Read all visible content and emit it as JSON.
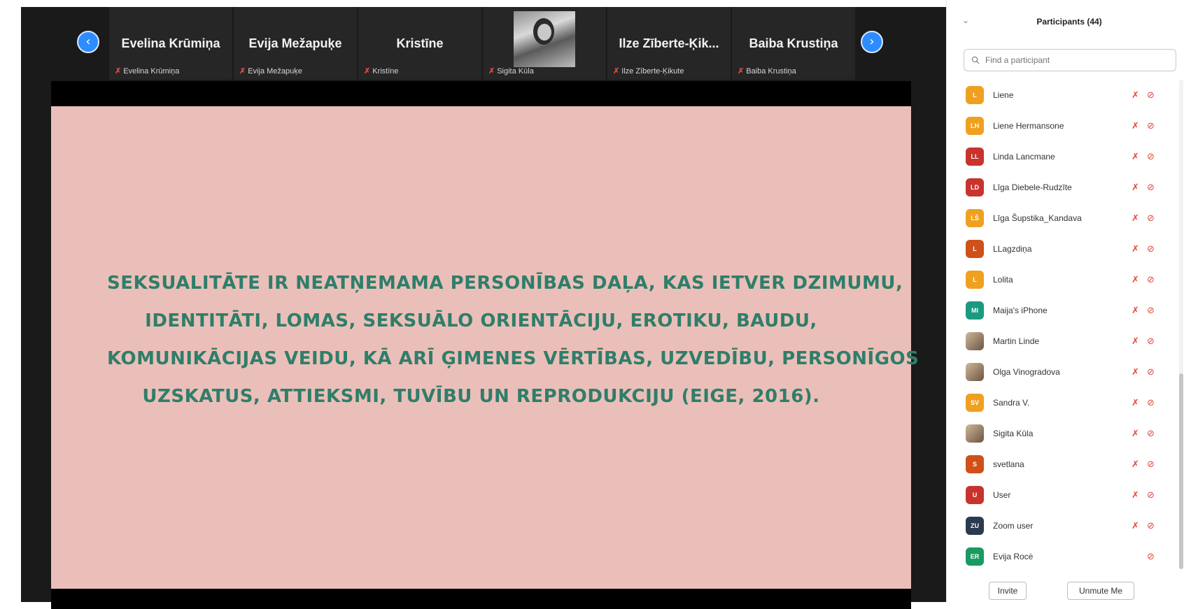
{
  "gallery": {
    "tiles": [
      {
        "name": "Evelina Krūmiņa",
        "label": "Evelina Krūmiņa"
      },
      {
        "name": "Evija Mežapuķe",
        "label": "Evija Mežapuķe"
      },
      {
        "name": "Kristīne",
        "label": "Kristīne"
      },
      {
        "name": "",
        "label": "Sigita Kūla"
      },
      {
        "name": "Ilze Zīberte-Ķik...",
        "label": "Ilze Zīberte-Ķikute"
      },
      {
        "name": "Baiba Krustiņa",
        "label": "Baiba Krustiņa"
      }
    ],
    "prev_icon": "‹",
    "next_icon": "›"
  },
  "slide": {
    "lines": [
      "SEKSUALITĀTE IR NEATŅEMAMA PERSONĪBAS DAĻA, KAS IETVER DZIMUMU,",
      "IDENTITĀTI, LOMAS, SEKSUĀLO ORIENTĀCIJU, EROTIKU, BAUDU,",
      "KOMUNIKĀCIJAS VEIDU, KĀ ARĪ ĢIMENES VĒRTĪBAS, UZVEDĪBU, PERSONĪGOS",
      "UZSKATUS, ATTIEKSMI, TUVĪBU UN REPRODUKCIJU (EIGE, 2016)."
    ],
    "text_color": "#2f7e6a",
    "background": "#ebbfb9"
  },
  "panel": {
    "title": "Participants (44)",
    "search_placeholder": "Find a participant",
    "participants": [
      {
        "initials": "L",
        "name": "Liene",
        "color": "#f0a020",
        "cam": true
      },
      {
        "initials": "LH",
        "name": "Liene Hermansone",
        "color": "#f0a020",
        "cam": true
      },
      {
        "initials": "LL",
        "name": "Linda Lancmane",
        "color": "#c8332e",
        "cam": true
      },
      {
        "initials": "LD",
        "name": "Līga Diebele-Rudzīte",
        "color": "#c8332e",
        "cam": true
      },
      {
        "initials": "LŠ",
        "name": "Līga Šupstika_Kandava",
        "color": "#f0a020",
        "cam": true
      },
      {
        "initials": "L",
        "name": "LLagzdiņa",
        "color": "#d0501a",
        "cam": true
      },
      {
        "initials": "L",
        "name": "Lolita",
        "color": "#f0a020",
        "cam": true
      },
      {
        "initials": "MI",
        "name": "Maija's iPhone",
        "color": "#1a9a80",
        "cam": true
      },
      {
        "initials": "",
        "name": "Martin Linde",
        "color": "photo",
        "cam": true
      },
      {
        "initials": "",
        "name": "Olga Vinogradova",
        "color": "photo",
        "cam": true
      },
      {
        "initials": "SV",
        "name": "Sandra V.",
        "color": "#f0a020",
        "cam": true
      },
      {
        "initials": "",
        "name": "Sigita Kūla",
        "color": "photo",
        "cam": true
      },
      {
        "initials": "S",
        "name": "svetlana",
        "color": "#d0501a",
        "cam": true
      },
      {
        "initials": "U",
        "name": "User",
        "color": "#c8332e",
        "cam": true
      },
      {
        "initials": "ZU",
        "name": "Zoom user",
        "color": "#2a3a50",
        "cam": true
      },
      {
        "initials": "ER",
        "name": "Evija Rocė",
        "color": "#1a9a60",
        "cam": false
      }
    ],
    "mic_icon": "✗",
    "cam_icon": "⊘",
    "invite_label": "Invite",
    "unmute_label": "Unmute Me"
  }
}
